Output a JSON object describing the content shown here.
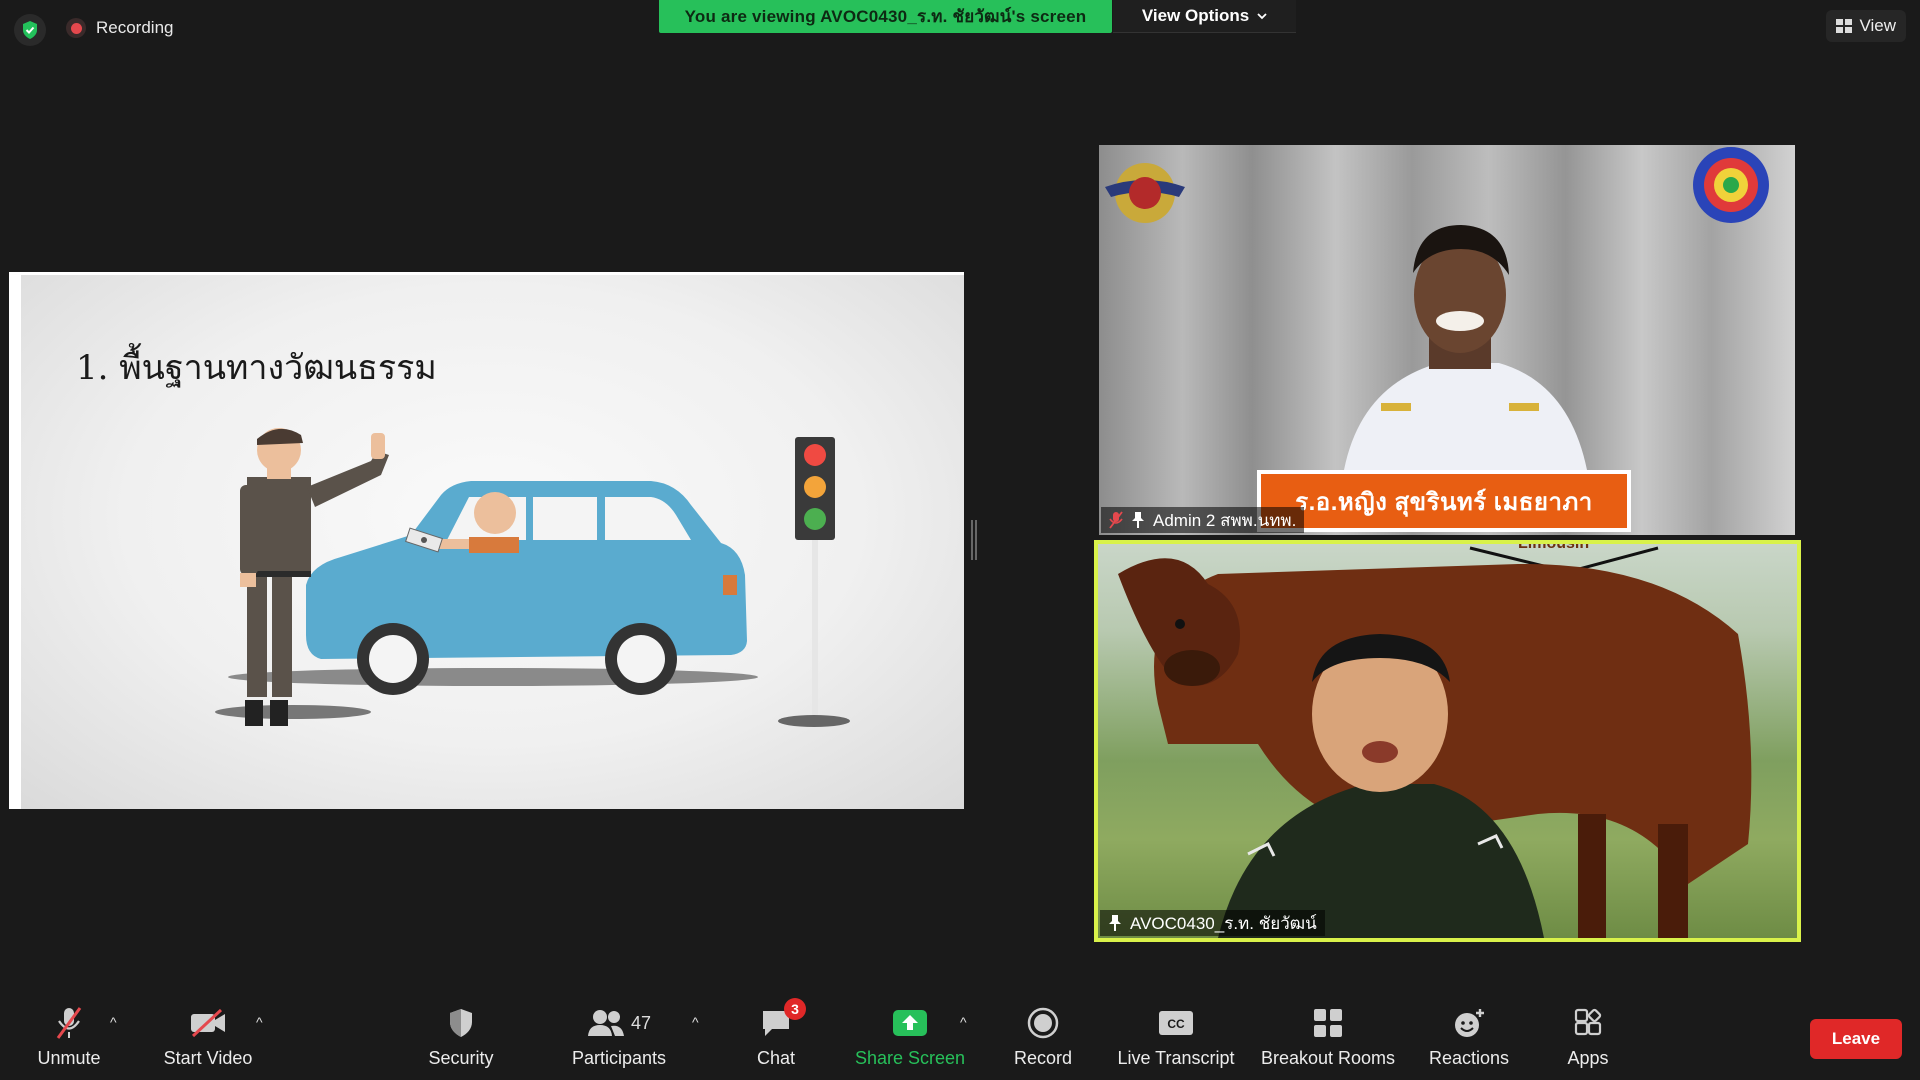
{
  "top_bar": {
    "recording_label": "Recording",
    "viewing_banner": "You are viewing AVOC0430_ร.ท. ชัยวัฒน์'s screen",
    "view_options_label": "View Options",
    "view_label": "View"
  },
  "slide": {
    "title": "1. พื้นฐานทางวัฒนธรรม"
  },
  "participants": [
    {
      "name": "Admin 2 สพพ.นทพ.",
      "overlay_caption": "ร.อ.หญิง สุขรินทร์ เมธยาภา"
    },
    {
      "name": "AVOC0430_ร.ท. ชัยวัฒน์",
      "overlay_caption": "Limousin"
    }
  ],
  "toolbar": {
    "unmute": "Unmute",
    "start_video": "Start Video",
    "security": "Security",
    "participants": "Participants",
    "participants_count": "47",
    "chat": "Chat",
    "chat_badge": "3",
    "share_screen": "Share Screen",
    "record": "Record",
    "live_transcript": "Live Transcript",
    "breakout_rooms": "Breakout Rooms",
    "reactions": "Reactions",
    "apps": "Apps",
    "leave": "Leave"
  },
  "colors": {
    "banner_green": "#27c05a",
    "share_green": "#27c05a",
    "leave_red": "#e02828",
    "active_speaker_border": "#d9f24a",
    "badge_red": "#e02828"
  }
}
